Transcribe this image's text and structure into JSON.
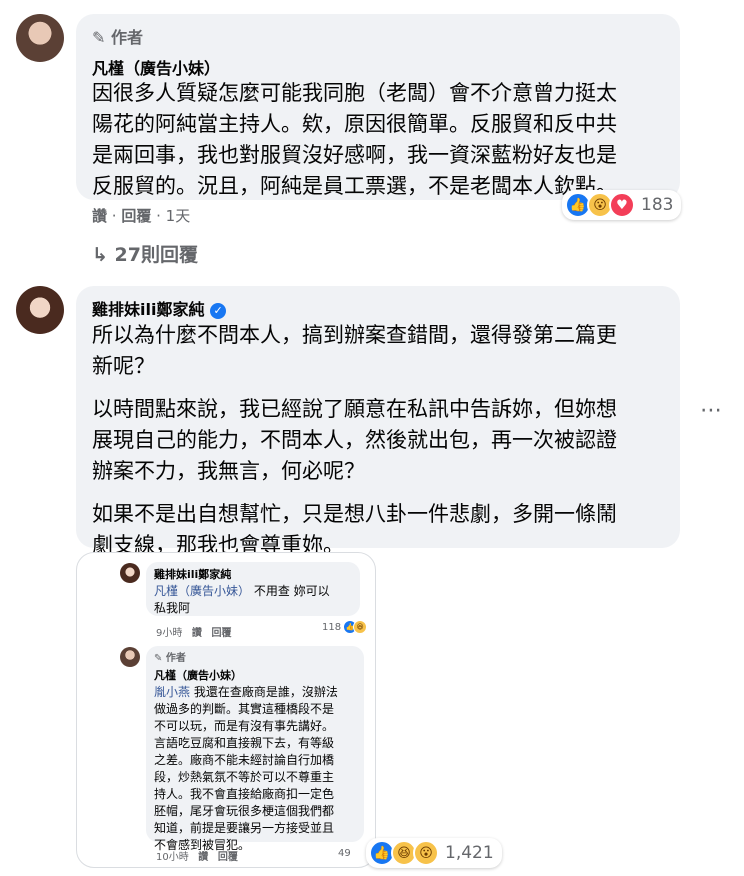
{
  "comment1": {
    "author_label": "作者",
    "name": "凡槿（廣告小妹）",
    "text_lines": [
      "因很多人質疑怎麼可能我同胞（老闆）會不介意曾力挺太",
      "陽花的阿純當主持人。欸，原因很簡單。反服貿和反中共",
      "是兩回事，我也對服貿沒好感啊，我一資深藍粉好友也是",
      "反服貿的。況且，阿純是員工票選，不是老闆本人欽點。"
    ],
    "actions": {
      "like": "讚",
      "reply": "回覆",
      "time": "1天"
    },
    "reaction_count": "183",
    "replies_link": "27則回覆"
  },
  "comment2": {
    "name": "雞排妹ili鄭家純",
    "para1_lines": [
      "所以為什麼不問本人，搞到辦案查錯間，還得發第二篇更",
      "新呢？"
    ],
    "para2_lines": [
      "以時間點來說，我已經說了願意在私訊中告訴妳，但妳想",
      "展現自己的能力，不問本人，然後就出包，再一次被認證",
      "辦案不力，我無言，何必呢？"
    ],
    "para3_lines": [
      "如果不是出自想幫忙，只是想八卦一件悲劇，多開一條鬧",
      "劇支線，那我也會尊重妳。"
    ],
    "more_icon": "ellipsis-icon"
  },
  "embedded": {
    "c1": {
      "name": "雞排妹ili鄭家純",
      "mention": "凡槿（廣告小妹）",
      "line1_rest": " 不用查 妳可以",
      "line2": "私我阿",
      "time": "9小時",
      "like": "讚",
      "reply": "回覆",
      "count": "118"
    },
    "c2": {
      "author_label": "作者",
      "name": "凡槿（廣告小妹）",
      "mention": "胤小燕",
      "line1_rest": " 我還在查廠商是誰，沒辦法",
      "lines": [
        "做過多的判斷。其實這種橋段不是",
        "不可以玩，而是有沒有事先講好。",
        "言語吃豆腐和直接親下去，有等級",
        "之差。廠商不能未經討論自行加橋",
        "段，炒熱氣氛不等於可以不尊重主",
        "持人。我不會直接給廠商扣一定色",
        "胚帽，尾牙會玩很多梗這個我們都",
        "知道，前提是要讓另一方接受並且",
        "不會感到被冒犯。"
      ],
      "time": "10小時",
      "like": "讚",
      "reply": "回覆",
      "count": "49"
    }
  },
  "bottom_reaction_count": "1,421"
}
